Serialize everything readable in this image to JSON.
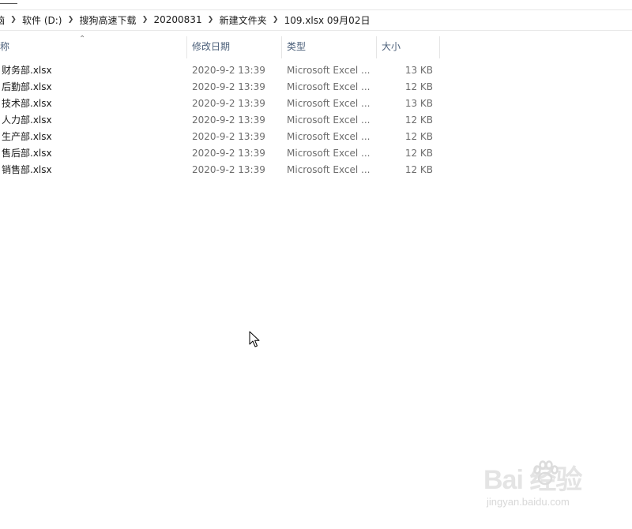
{
  "breadcrumb": [
    {
      "label": "脑"
    },
    {
      "label": "软件 (D:)"
    },
    {
      "label": "搜狗高速下载"
    },
    {
      "label": "20200831"
    },
    {
      "label": "新建文件夹"
    },
    {
      "label": "109.xlsx 09月02日"
    }
  ],
  "columns": {
    "name": "称",
    "date": "修改日期",
    "type": "类型",
    "size": "大小"
  },
  "files": [
    {
      "name": "财务部.xlsx",
      "date": "2020-9-2 13:39",
      "type": "Microsoft Excel ...",
      "size": "13 KB"
    },
    {
      "name": "后勤部.xlsx",
      "date": "2020-9-2 13:39",
      "type": "Microsoft Excel ...",
      "size": "12 KB"
    },
    {
      "name": "技术部.xlsx",
      "date": "2020-9-2 13:39",
      "type": "Microsoft Excel ...",
      "size": "13 KB"
    },
    {
      "name": "人力部.xlsx",
      "date": "2020-9-2 13:39",
      "type": "Microsoft Excel ...",
      "size": "12 KB"
    },
    {
      "name": "生产部.xlsx",
      "date": "2020-9-2 13:39",
      "type": "Microsoft Excel ...",
      "size": "12 KB"
    },
    {
      "name": "售后部.xlsx",
      "date": "2020-9-2 13:39",
      "type": "Microsoft Excel ...",
      "size": "12 KB"
    },
    {
      "name": "销售部.xlsx",
      "date": "2020-9-2 13:39",
      "type": "Microsoft Excel ...",
      "size": "12 KB"
    }
  ],
  "watermark": {
    "brand": "Bai 经验",
    "url": "jingyan.baidu.com"
  },
  "colors": {
    "header_text": "#4c607a",
    "secondary_text": "#6d6d6d"
  }
}
